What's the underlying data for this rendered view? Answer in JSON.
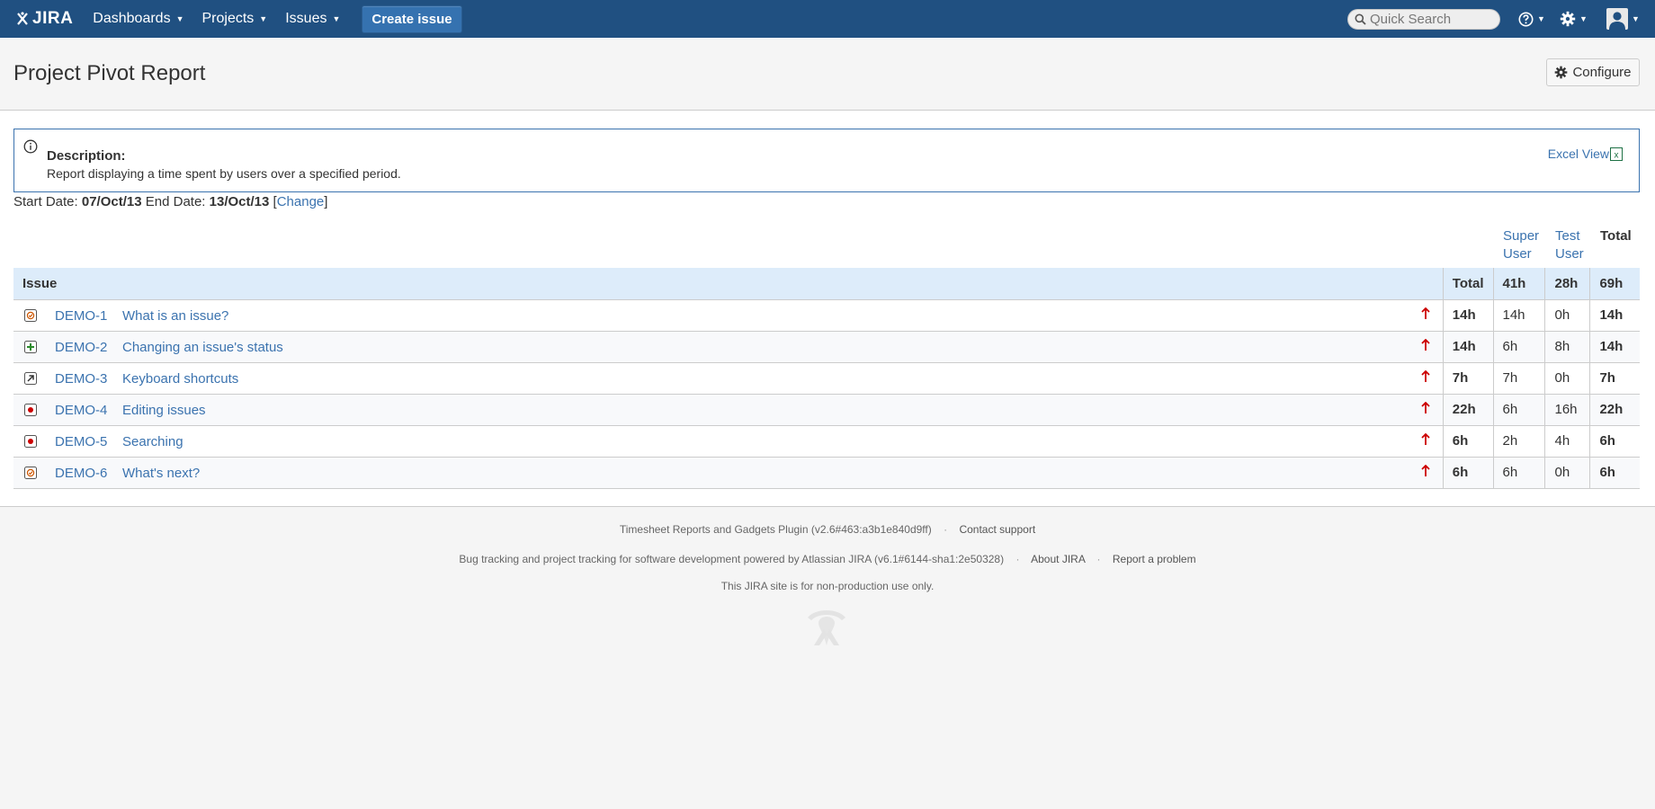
{
  "header": {
    "logo_text": "JIRA",
    "nav": [
      {
        "label": "Dashboards"
      },
      {
        "label": "Projects"
      },
      {
        "label": "Issues"
      }
    ],
    "create_label": "Create issue",
    "search_placeholder": "Quick Search",
    "help_icon": "help-icon",
    "settings_icon": "gear-icon",
    "avatar_icon": "user-avatar-icon"
  },
  "page": {
    "title": "Project Pivot Report",
    "configure_label": "Configure"
  },
  "description": {
    "title": "Description:",
    "text": "Report displaying a time spent by users over a specified period.",
    "excel_label": "Excel View",
    "excel_icon_letter": "x"
  },
  "dates": {
    "start_label": "Start Date:",
    "start_value": "07/Oct/13",
    "end_label": "End Date:",
    "end_value": "13/Oct/13",
    "change_label": "Change"
  },
  "columns": {
    "users": [
      {
        "line1": "Super",
        "line2": "User"
      },
      {
        "line1": "Test",
        "line2": "User"
      }
    ],
    "total_label": "Total"
  },
  "table": {
    "issue_header": "Issue",
    "total_header": "Total",
    "user_totals": [
      "41h",
      "28h"
    ],
    "grand_total": "69h",
    "rows": [
      {
        "key": "DEMO-1",
        "summary": "What is an issue?",
        "type": "task",
        "total": "14h",
        "users": [
          "14h",
          "0h"
        ],
        "row_total": "14h"
      },
      {
        "key": "DEMO-2",
        "summary": "Changing an issue's status",
        "type": "new-feature",
        "total": "14h",
        "users": [
          "6h",
          "8h"
        ],
        "row_total": "14h"
      },
      {
        "key": "DEMO-3",
        "summary": "Keyboard shortcuts",
        "type": "improvement",
        "total": "7h",
        "users": [
          "7h",
          "0h"
        ],
        "row_total": "7h"
      },
      {
        "key": "DEMO-4",
        "summary": "Editing issues",
        "type": "bug",
        "total": "22h",
        "users": [
          "6h",
          "16h"
        ],
        "row_total": "22h"
      },
      {
        "key": "DEMO-5",
        "summary": "Searching",
        "type": "bug",
        "total": "6h",
        "users": [
          "2h",
          "4h"
        ],
        "row_total": "6h"
      },
      {
        "key": "DEMO-6",
        "summary": "What's next?",
        "type": "task",
        "total": "6h",
        "users": [
          "6h",
          "0h"
        ],
        "row_total": "6h"
      }
    ]
  },
  "footer": {
    "plugin_text": "Timesheet Reports and Gadgets Plugin (v2.6#463:a3b1e840d9ff)",
    "contact_label": "Contact support",
    "powered_text": "Bug tracking and project tracking for software development powered by Atlassian JIRA (v6.1#6144-sha1:2e50328)",
    "about_label": "About JIRA",
    "report_label": "Report a problem",
    "nonprod_text": "This JIRA site is for non-production use only.",
    "separator": "·"
  },
  "colors": {
    "header_bg": "#205081",
    "link": "#3b73af",
    "table_header_bg": "#ddecfa",
    "priority_red": "#cc0000"
  }
}
